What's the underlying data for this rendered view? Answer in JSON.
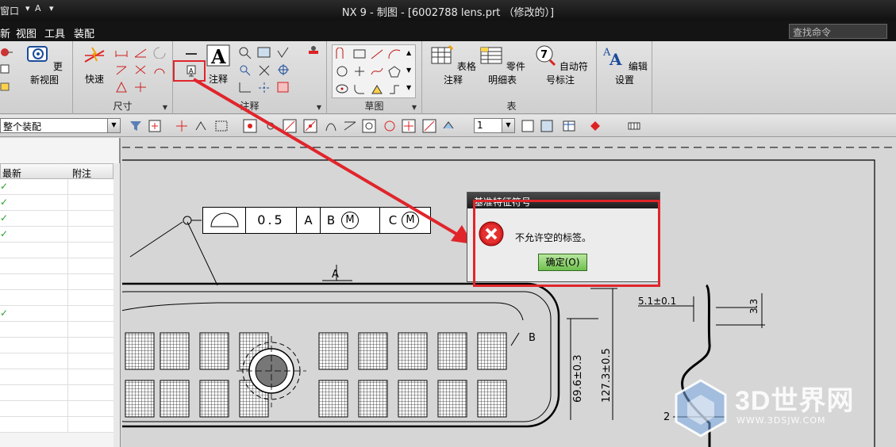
{
  "titlebar": {
    "title": "NX 9 - 制图 - [6002788 lens.prt （修改的）]",
    "window_menu": "窗口"
  },
  "menubar": {
    "items": [
      "新",
      "视图",
      "工具",
      "装配"
    ],
    "search_placeholder": "查找命令"
  },
  "ribbon": {
    "groups": [
      {
        "label": "",
        "buttons": [
          "更新视图"
        ]
      },
      {
        "label": "尺寸",
        "buttons": [
          "快速"
        ]
      },
      {
        "label": "注释",
        "buttons": [
          "注释"
        ]
      },
      {
        "label": "草图",
        "buttons": []
      },
      {
        "label": "表",
        "buttons": [
          "表格注释",
          "零件明细表",
          "自动符号标注"
        ]
      },
      {
        "label": "",
        "buttons": [
          "编辑设置"
        ]
      }
    ]
  },
  "toolbar": {
    "filter_value": "整个装配",
    "scale_value": "1"
  },
  "navigator": {
    "columns": [
      "最新",
      "附注"
    ],
    "checked_rows": [
      0,
      1,
      2,
      3,
      8
    ]
  },
  "drawing": {
    "fcf_cells": [
      "0.5",
      "A",
      "B",
      "M",
      "C",
      "M"
    ],
    "datum_a": "A",
    "datum_b": "B",
    "dims": [
      "69.6±0.3",
      "127.3±0.5",
      "5.1±0.1",
      "3.3",
      "2"
    ]
  },
  "dialog": {
    "title": "基准特征符号",
    "message": "不允许空的标签。",
    "ok_label": "确定(O)"
  },
  "watermark": {
    "brand": "3D世界网",
    "url": "WWW.3DSJW.COM"
  },
  "colors": {
    "highlight": "#e0252b",
    "ok_green": "#6fbf4e"
  }
}
